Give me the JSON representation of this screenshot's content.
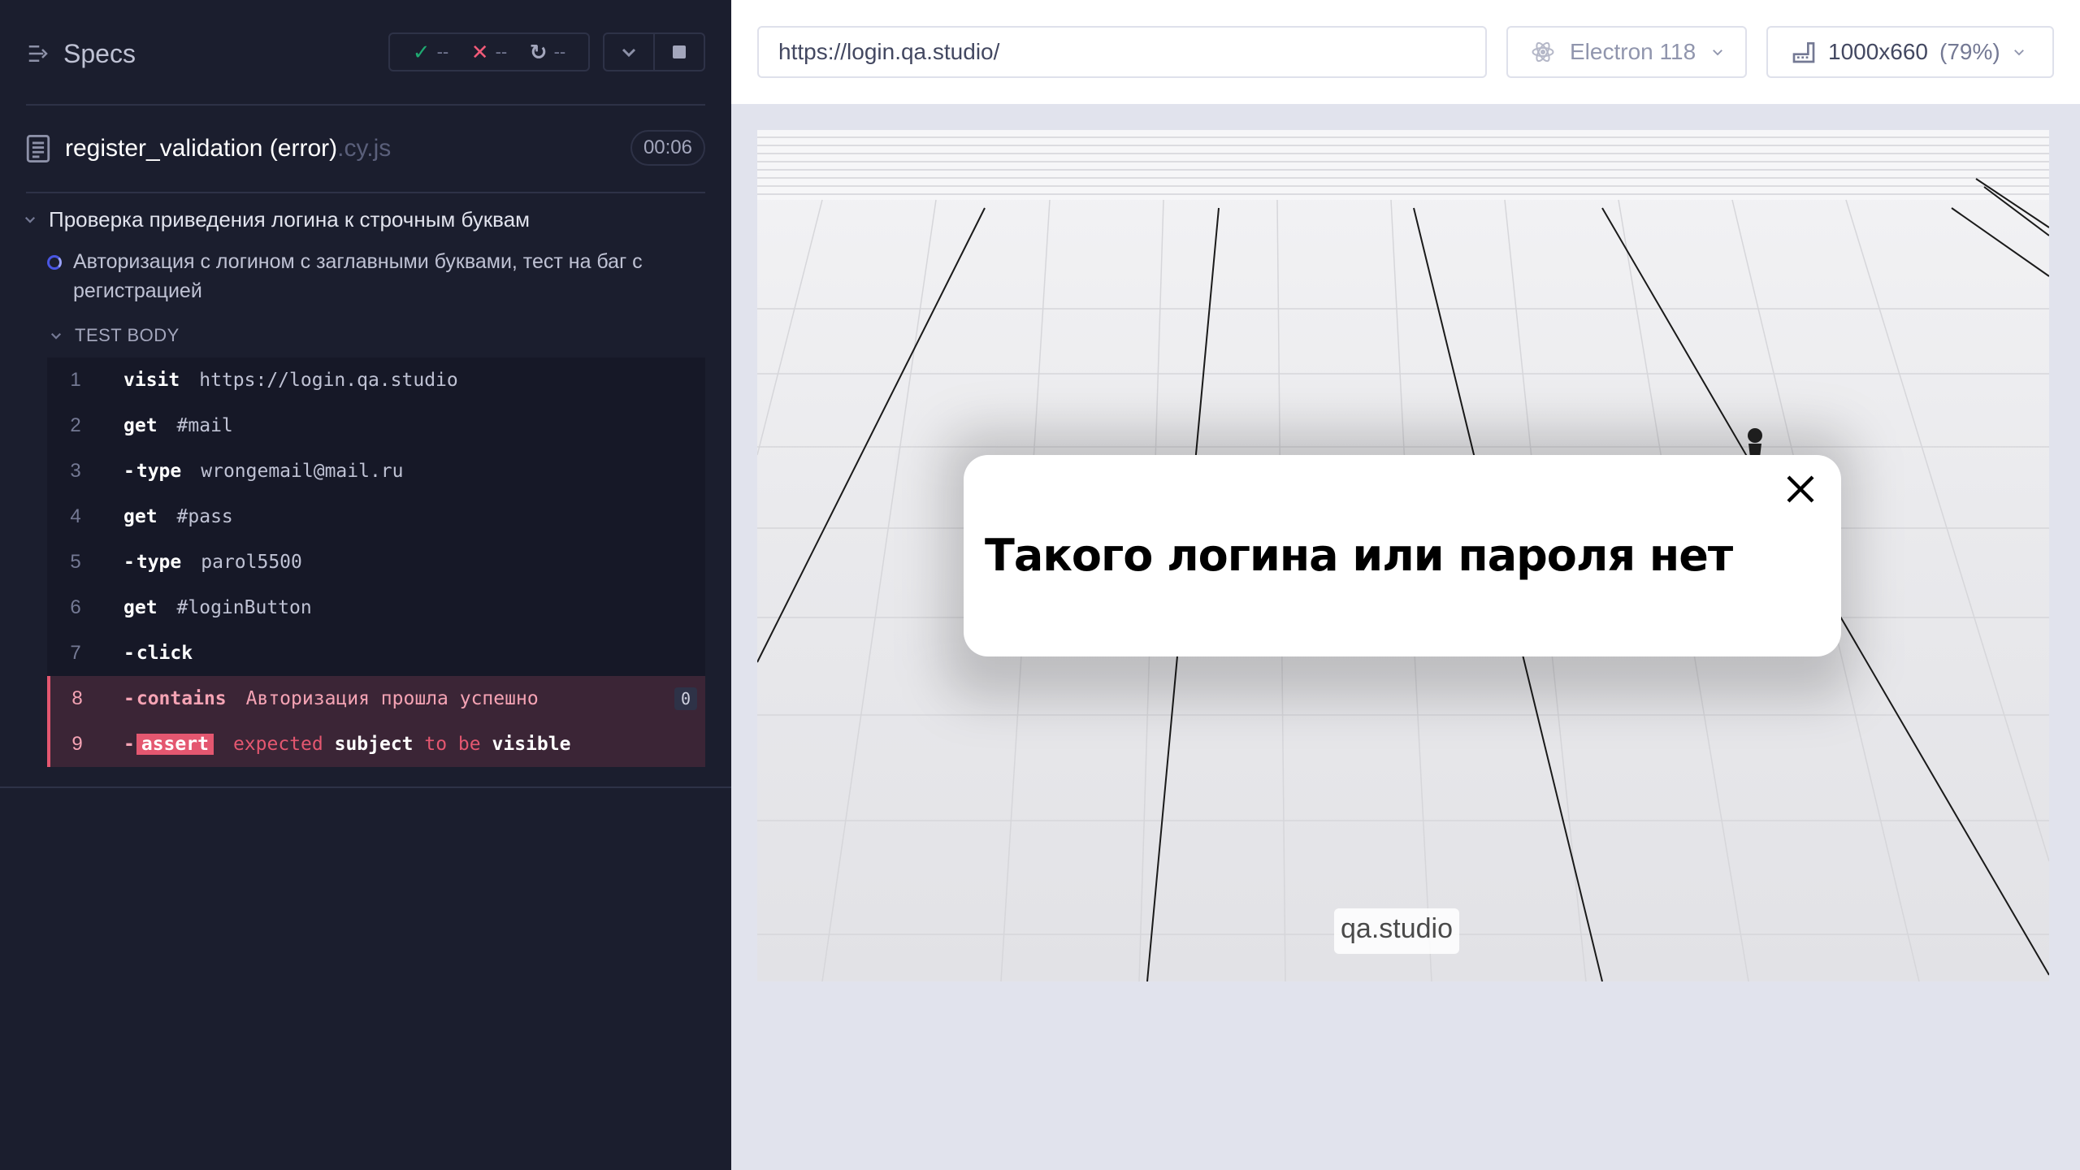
{
  "reporter": {
    "specs_label": "Specs",
    "stats": {
      "passed": "--",
      "failed": "--",
      "pending": "--"
    },
    "spec": {
      "name": "register_validation (error)",
      "ext": ".cy.js",
      "duration": "00:06"
    },
    "suite_title": "Проверка приведения логина к строчным буквам",
    "test_title": "Авторизация с логином с заглавными буквами, тест на баг с регистрацией",
    "test_body_label": "TEST BODY",
    "commands": [
      {
        "num": "1",
        "name": "visit",
        "msg": "https://login.qa.studio"
      },
      {
        "num": "2",
        "name": "get",
        "msg": "#mail"
      },
      {
        "num": "3",
        "name": "type",
        "msg": "wrongemail@mail.ru"
      },
      {
        "num": "4",
        "name": "get",
        "msg": "#pass"
      },
      {
        "num": "5",
        "name": "type",
        "msg": "parol5500"
      },
      {
        "num": "6",
        "name": "get",
        "msg": "#loginButton"
      },
      {
        "num": "7",
        "name": "click",
        "msg": ""
      },
      {
        "num": "8",
        "name": "contains",
        "msg": "Авторизация прошла успешно",
        "badge": "0"
      },
      {
        "num": "9",
        "name": "assert",
        "msg_parts": [
          "expected",
          "subject",
          "to be",
          "visible"
        ]
      }
    ]
  },
  "aut": {
    "url": "https://login.qa.studio/",
    "browser": "Electron 118",
    "viewport": "1000x660",
    "scale": "(79%)",
    "modal_message": "Такого логина или пароля нет",
    "brand": "qa.studio"
  },
  "colors": {
    "reporter_bg": "#1b1e2e",
    "pass": "#1fa971",
    "fail": "#f15a78",
    "failed_row_bg": "#3b2536"
  },
  "icons": [
    "specs-icon",
    "check-icon",
    "x-icon",
    "spinner-icon",
    "chevron-down-icon",
    "stop-icon",
    "file-icon",
    "electron-icon",
    "viewport-icon",
    "close-icon"
  ]
}
